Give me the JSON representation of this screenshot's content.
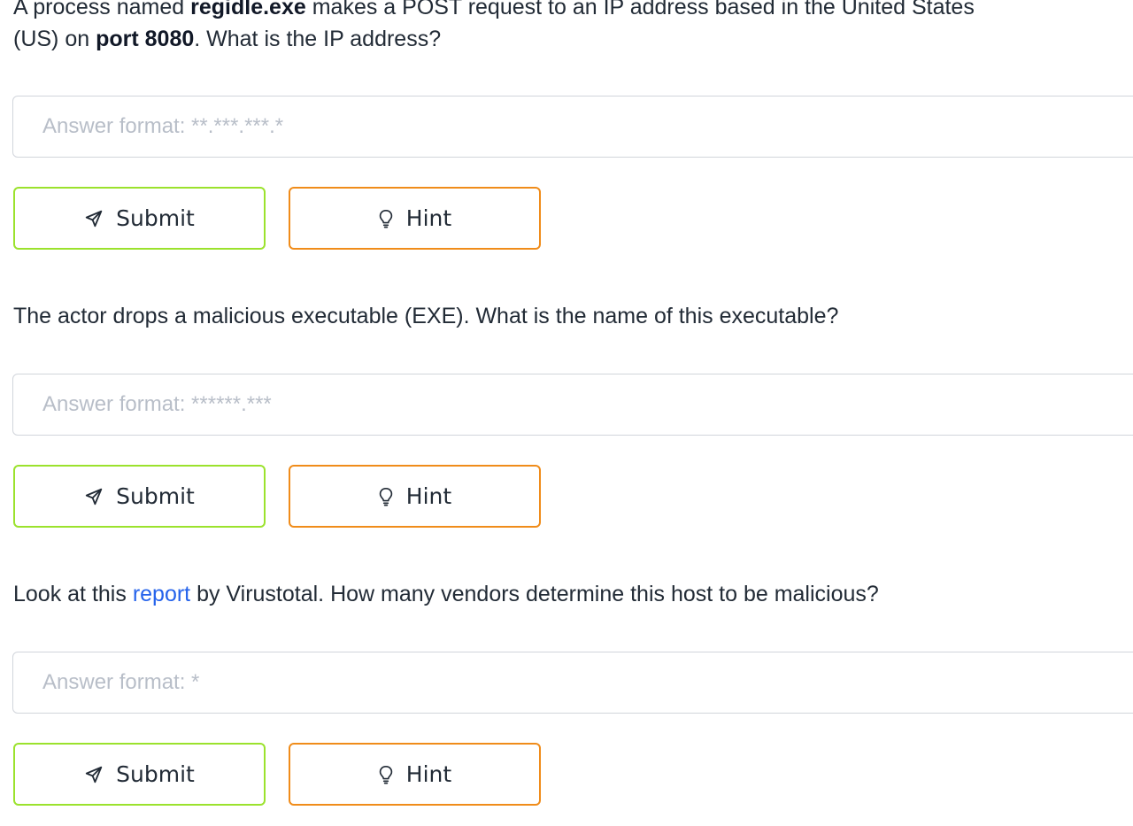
{
  "questions": [
    {
      "text_parts": [
        {
          "t": "A process named ",
          "style": "plain"
        },
        {
          "t": "regidle.exe",
          "style": "bold"
        },
        {
          "t": " makes a POST request to an IP address based in the United States",
          "style": "plain"
        },
        {
          "t": "(US) on ",
          "style": "plain",
          "newline": true
        },
        {
          "t": "port 8080",
          "style": "bold"
        },
        {
          "t": ". What is the IP address?",
          "style": "plain"
        }
      ],
      "answer_placeholder": "Answer format: **.***.***.*",
      "answer_value": "",
      "submit_label": "Submit",
      "hint_label": "Hint"
    },
    {
      "text_parts": [
        {
          "t": "The actor drops a malicious executable (EXE). What is the name of this executable?",
          "style": "plain"
        }
      ],
      "answer_placeholder": "Answer format: ******.***",
      "answer_value": "",
      "submit_label": "Submit",
      "hint_label": "Hint"
    },
    {
      "text_parts": [
        {
          "t": "Look at this ",
          "style": "plain"
        },
        {
          "t": "report",
          "style": "link"
        },
        {
          "t": " by Virustotal. How many vendors determine this host to be malicious?",
          "style": "plain"
        }
      ],
      "answer_placeholder": "Answer format: *",
      "answer_value": "",
      "submit_label": "Submit",
      "hint_label": "Hint"
    }
  ],
  "icons": {
    "submit": "paper-plane-icon",
    "hint": "lightbulb-icon"
  },
  "colors": {
    "submit_border": "#9be22d",
    "hint_border": "#f08c1a",
    "link": "#2563eb",
    "placeholder": "#b8bec8"
  }
}
